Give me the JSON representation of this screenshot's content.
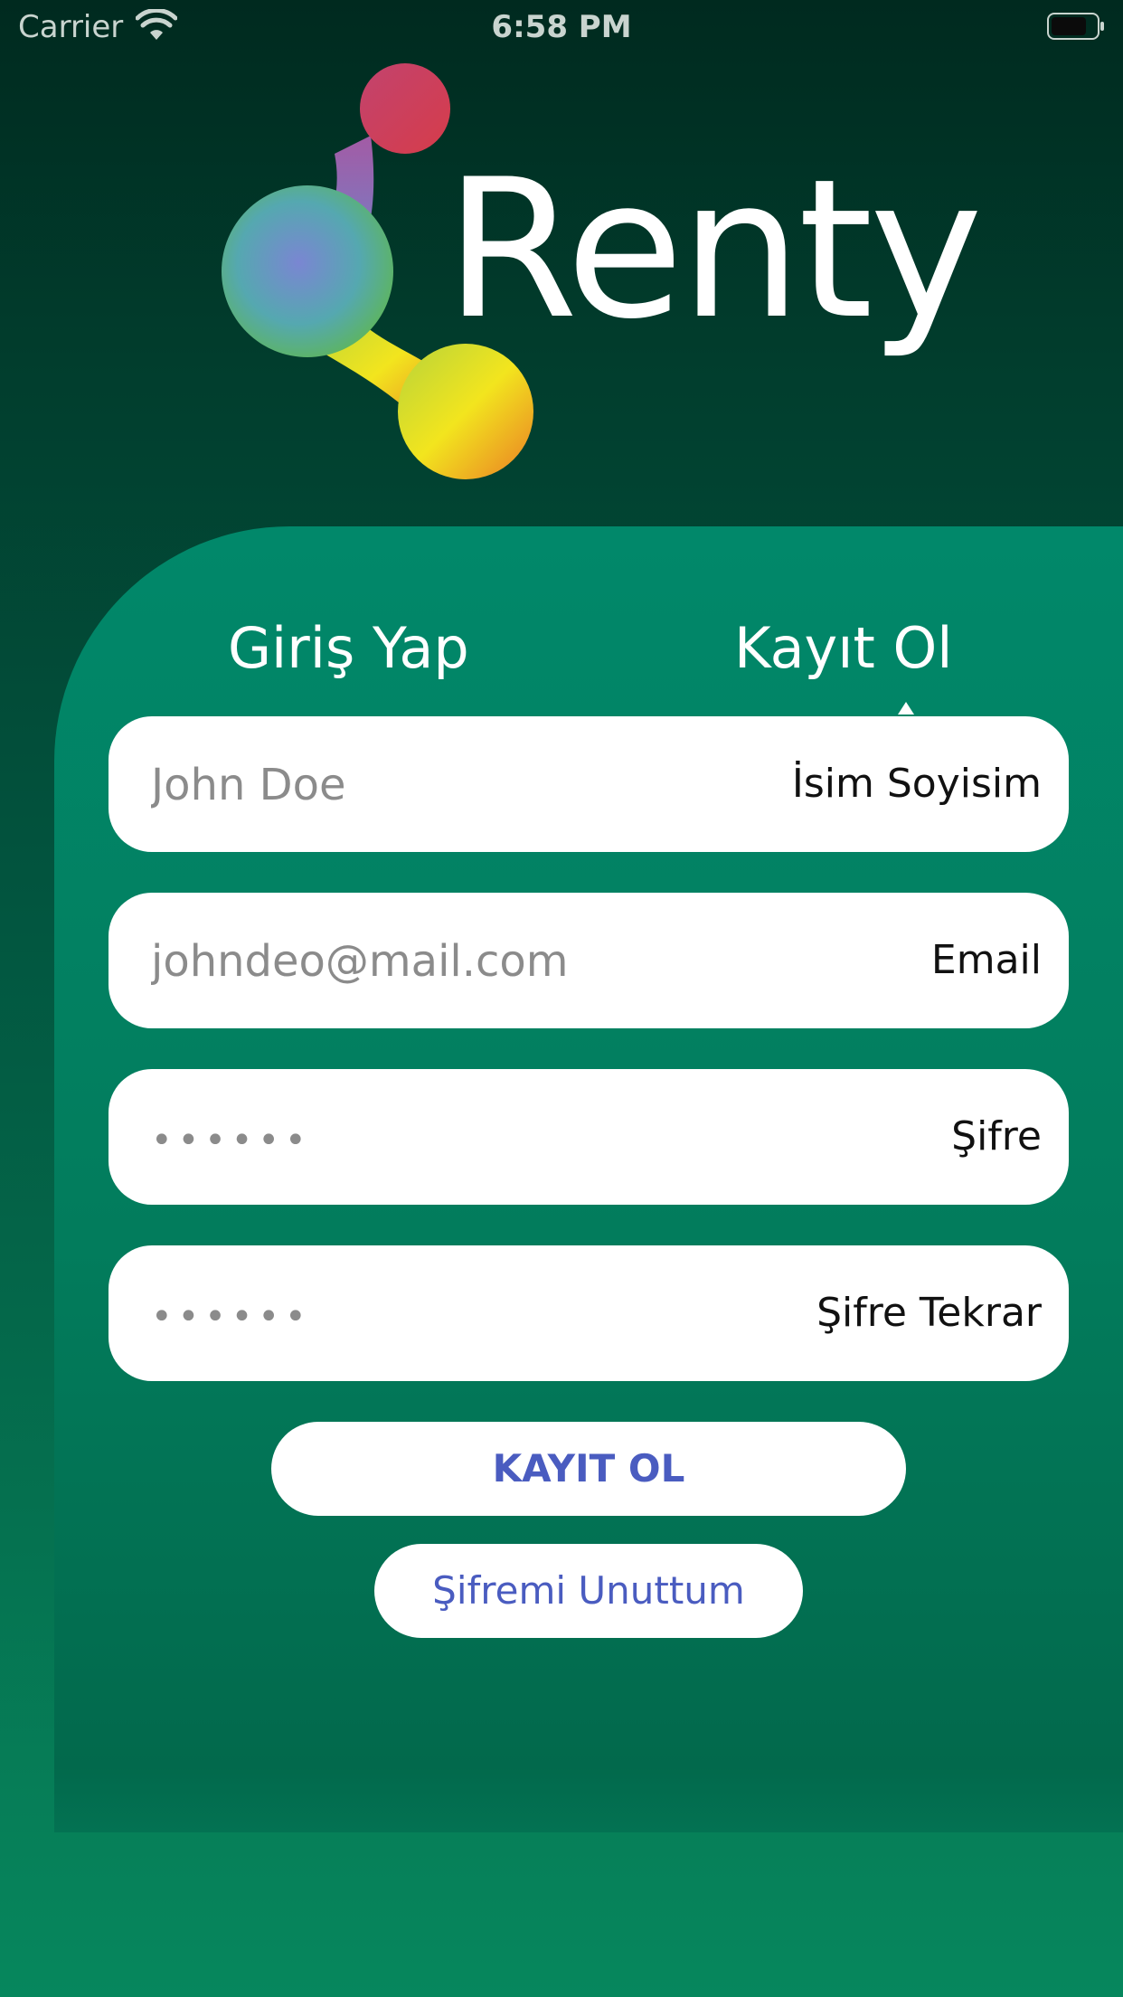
{
  "status_bar": {
    "carrier": "Carrier",
    "time": "6:58 PM",
    "wifi_icon": "wifi-icon",
    "battery_icon": "battery-icon"
  },
  "logo": {
    "text": "Renty",
    "icon": "renty-logo-icon"
  },
  "tabs": {
    "login_label": "Giriş Yap",
    "register_label": "Kayıt Ol",
    "active": "register"
  },
  "form": {
    "name": {
      "placeholder": "John Doe",
      "label": "İsim Soyisim"
    },
    "email": {
      "placeholder": "johndeo@mail.com",
      "label": "Email"
    },
    "password": {
      "placeholder": "••••••",
      "label": "Şifre"
    },
    "password_repeat": {
      "placeholder": "••••••",
      "label": "Şifre Tekrar"
    }
  },
  "buttons": {
    "register_label": "KAYIT OL",
    "forgot_label": "Şifremi Unuttum"
  },
  "colors": {
    "background_dark": "#002a1f",
    "background_green": "#06875d",
    "card_green": "#01886a",
    "button_text": "#4a5cc0"
  }
}
